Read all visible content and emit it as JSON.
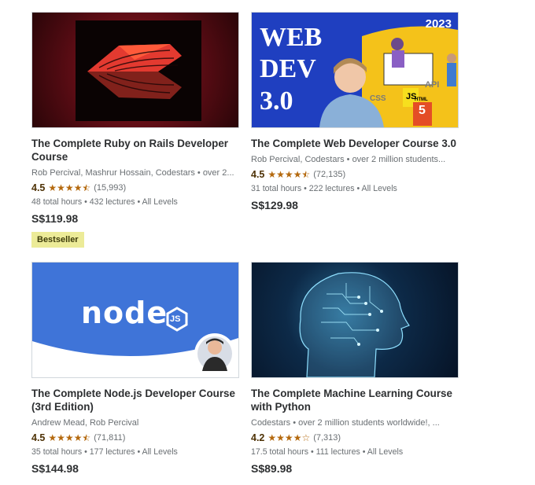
{
  "courses": [
    {
      "title": "The Complete Ruby on Rails Developer Course",
      "instructors": "Rob Percival, Mashrur Hossain, Codestars • over 2...",
      "rating": "4.5",
      "rating_value": 4.5,
      "reviews": "(15,993)",
      "meta": "48 total hours • 432 lectures • All Levels",
      "price": "S$119.98",
      "badge": "Bestseller",
      "thumbnail_icon": "ruby-on-rails-icon"
    },
    {
      "title": "The Complete Web Developer Course 3.0",
      "instructors": "Rob Percival, Codestars • over 2 million students...",
      "rating": "4.5",
      "rating_value": 4.5,
      "reviews": "(72,135)",
      "meta": "31 total hours • 222 lectures • All Levels",
      "price": "S$129.98",
      "thumb_text": {
        "line1": "WEB",
        "line2": "DEV",
        "line3": "3.0",
        "year": "2023",
        "css": "CSS",
        "js": "JS",
        "api": "API",
        "html": "HTML",
        "five": "5"
      }
    },
    {
      "title": "The Complete Node.js Developer Course (3rd Edition)",
      "instructors": "Andrew Mead, Rob Percival",
      "rating": "4.5",
      "rating_value": 4.5,
      "reviews": "(71,811)",
      "meta": "35 total hours • 177 lectures • All Levels",
      "price": "S$144.98",
      "logo_text": "node",
      "logo_badge": "JS"
    },
    {
      "title": "The Complete Machine Learning Course with Python",
      "instructors": "Codestars • over 2 million students worldwide!, ...",
      "rating": "4.2",
      "rating_value": 4.2,
      "reviews": "(7,313)",
      "meta": "17.5 total hours • 111 lectures • All Levels",
      "price": "S$89.98",
      "thumbnail_icon": "ai-head-icon"
    }
  ],
  "colors": {
    "star": "#b4690e",
    "rating": "#4d3105",
    "bestseller_bg": "#eceb98",
    "webdev_blue": "#1f3fc0",
    "node_blue": "#3f74d8",
    "ml_bg": "#061326"
  }
}
